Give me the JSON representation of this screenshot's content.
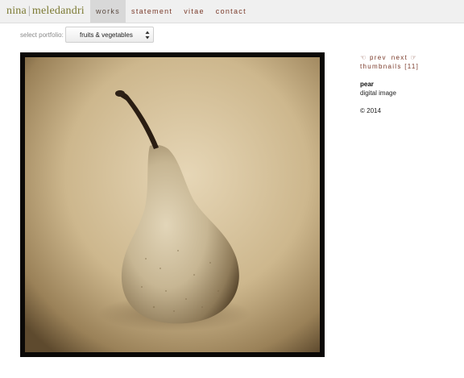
{
  "header": {
    "logo_first": "nina",
    "logo_sep": "|",
    "logo_last": "meledandri",
    "nav": [
      {
        "label": "works"
      },
      {
        "label": "statement"
      },
      {
        "label": "vitae"
      },
      {
        "label": "contact"
      }
    ]
  },
  "portfolio": {
    "label": "select portfolio:",
    "selected": "fruits & vegetables"
  },
  "artwork": {
    "prev_label": "prev",
    "next_label": "next",
    "thumbnails_label": "thumbnails [11]",
    "title": "pear",
    "medium": "digital image",
    "copyright": "© 2014",
    "image_icon": "pear-photograph"
  },
  "colors": {
    "logo": "#7c7a33",
    "nav_link": "#7a3a2a",
    "nav_active_bg": "#d8d8d8",
    "topbar_bg": "#f0f0f0",
    "photo_sepia": "#c9b48a"
  }
}
